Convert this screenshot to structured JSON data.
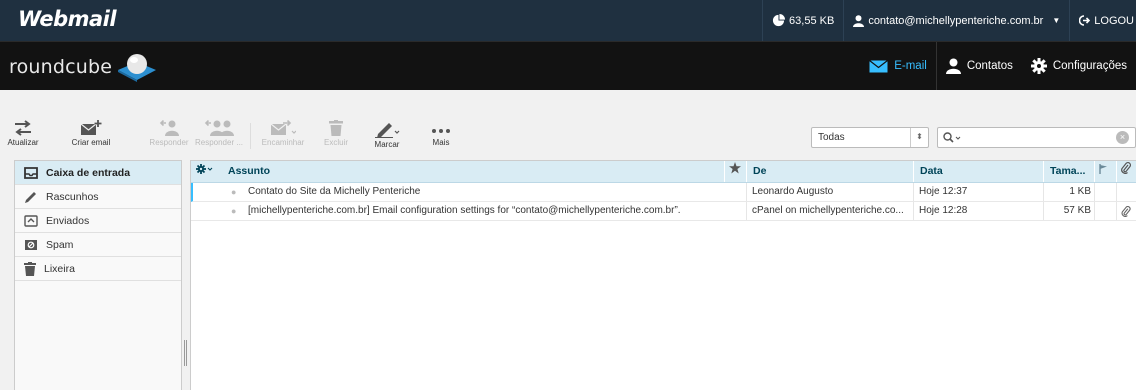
{
  "cpanel": {
    "brand": "Webmail",
    "quota": "63,55 KB",
    "account": "contato@michellypenteriche.com.br",
    "logout": "LOGOU"
  },
  "header": {
    "logo_text": "roundcube",
    "nav": [
      {
        "label": "E-mail",
        "icon": "envelope-icon",
        "active": true
      },
      {
        "label": "Contatos",
        "icon": "person-icon"
      },
      {
        "label": "Configurações",
        "icon": "gear-icon"
      }
    ]
  },
  "toolbar": {
    "refresh": "Atualizar",
    "compose": "Criar email",
    "reply": "Responder",
    "reply_all": "Responder ...",
    "forward": "Encaminhar",
    "delete": "Excluir",
    "mark": "Marcar",
    "more": "Mais"
  },
  "filter": {
    "selected": "Todas"
  },
  "search": {
    "placeholder": ""
  },
  "folders": [
    {
      "label": "Caixa de entrada",
      "icon": "inbox-icon",
      "selected": true
    },
    {
      "label": "Rascunhos",
      "icon": "pencil-icon"
    },
    {
      "label": "Enviados",
      "icon": "sent-icon"
    },
    {
      "label": "Spam",
      "icon": "spam-icon"
    },
    {
      "label": "Lixeira",
      "icon": "trash-icon"
    }
  ],
  "list": {
    "columns": {
      "subject": "Assunto",
      "from": "De",
      "date": "Data",
      "size": "Tama..."
    },
    "rows": [
      {
        "subject": "Contato do Site da Michelly Penteriche",
        "from": "Leonardo Augusto",
        "date": "Hoje 12:37",
        "size": "1 KB",
        "attachment": false
      },
      {
        "subject": "[michellypenteriche.com.br] Email configuration settings for “contato@michellypenteriche.com.br”.",
        "from": "cPanel on michellypenteriche.co...",
        "date": "Hoje 12:28",
        "size": "57 KB",
        "attachment": true
      }
    ]
  },
  "colors": {
    "accent": "#37beff",
    "selected_bg": "#d9ecf4",
    "cpanel_bg": "#1f3040",
    "header_bg": "#121212"
  }
}
